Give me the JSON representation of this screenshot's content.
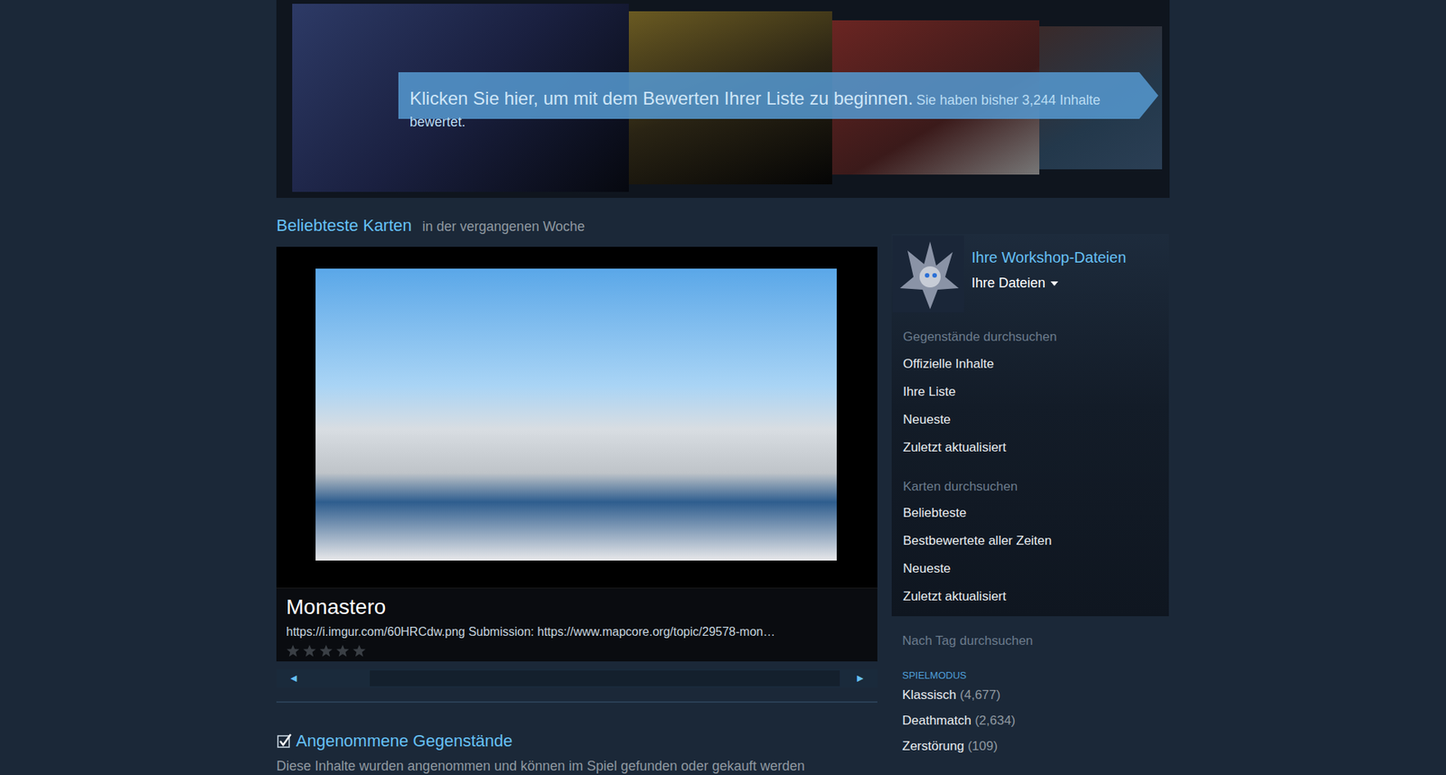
{
  "banner": {
    "prompt": "Klicken Sie hier, um mit dem Bewerten Ihrer Liste zu beginnen.",
    "count_text": "Sie haben bisher 3,244 Inhalte bewertet."
  },
  "featured": {
    "heading": "Beliebteste Karten",
    "subheading": "in der vergangenen Woche",
    "title": "Monastero",
    "description": "https://i.imgur.com/60HRCdw.png Submission: https://www.mapcore.org/topic/29578-mon…",
    "stars": 0,
    "prev": "◄",
    "next": "►"
  },
  "accepted": {
    "checked": true,
    "title": "Angenommene Gegenstände",
    "description": "Diese Inhalte wurden angenommen und können im Spiel gefunden oder gekauft werden"
  },
  "sidebar": {
    "title": "Ihre Workshop-Dateien",
    "dropdown": "Ihre Dateien",
    "sections": [
      {
        "heading": "Gegenstände durchsuchen",
        "items": [
          "Offizielle Inhalte",
          "Ihre Liste",
          "Neueste",
          "Zuletzt aktualisiert"
        ]
      },
      {
        "heading": "Karten durchsuchen",
        "items": [
          "Beliebteste",
          "Bestbewertete aller Zeiten",
          "Neueste",
          "Zuletzt aktualisiert"
        ]
      }
    ]
  },
  "tags": {
    "heading": "Nach Tag durchsuchen",
    "group": "SPIELMODUS",
    "items": [
      {
        "label": "Klassisch",
        "count": "(4,677)"
      },
      {
        "label": "Deathmatch",
        "count": "(2,634)"
      },
      {
        "label": "Zerstörung",
        "count": "(109)"
      }
    ]
  }
}
